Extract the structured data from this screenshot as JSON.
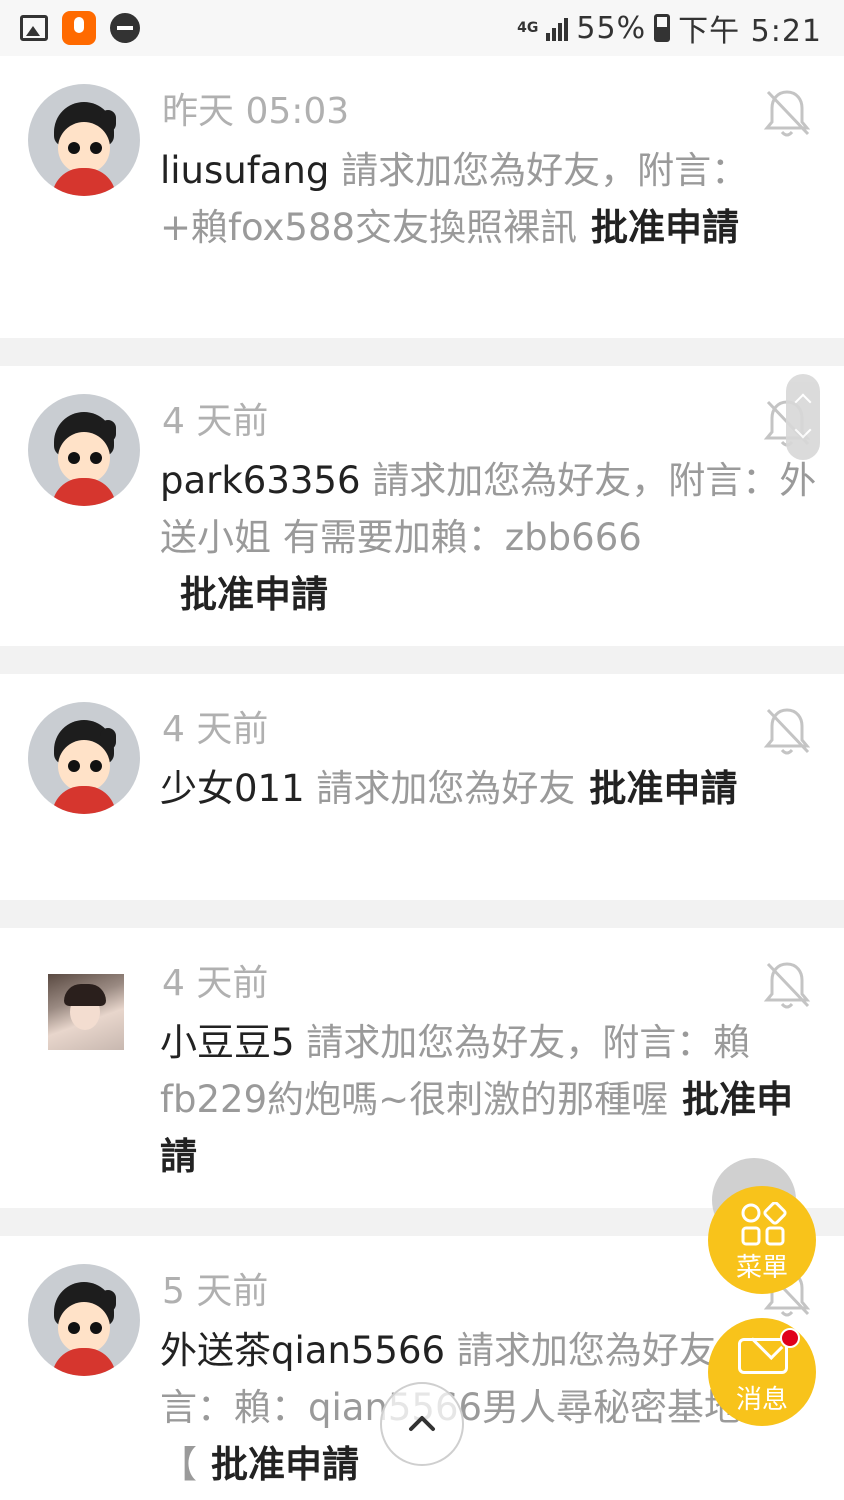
{
  "status_bar": {
    "network": "4G",
    "battery": "55%",
    "time": "下午 5:21"
  },
  "notifications": [
    {
      "time": "昨天 05:03",
      "username": "liusufang",
      "message": " 請求加您為好友，附言：+賴fox588交友換照裸訊",
      "action": "批准申請"
    },
    {
      "time": "4 天前",
      "username": "park63356",
      "message": " 請求加您為好友，附言：外送小姐 有需要加賴：zbb666",
      "action": "批准申請"
    },
    {
      "time": "4 天前",
      "username": "少女011",
      "message": " 請求加您為好友",
      "action": "批准申請"
    },
    {
      "time": "4 天前",
      "username": "小豆豆5",
      "message": " 請求加您為好友，附言：賴fb229約炮嗎~很刺激的那種喔",
      "action": "批准申請"
    },
    {
      "time": "5 天前",
      "username": "外送茶qian5566",
      "message": " 請求加您為好友，附言：賴：qian5566男人尋秘密基地 【",
      "action": "批准申請"
    }
  ],
  "fab": {
    "menu_label": "菜單",
    "message_label": "消息"
  },
  "icons": {
    "mute": "bell-off-icon",
    "scroll_top": "chevron-up-icon"
  }
}
